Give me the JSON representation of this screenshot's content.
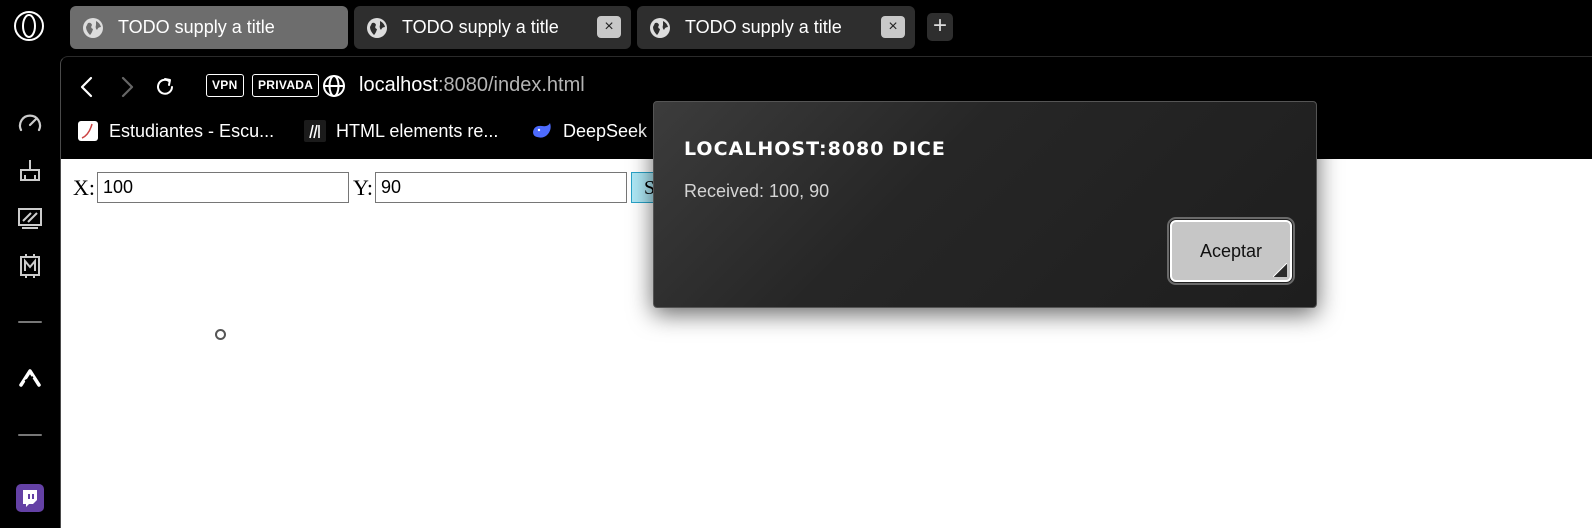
{
  "tabs": [
    {
      "title": "TODO supply a title",
      "active": true,
      "closable": false
    },
    {
      "title": "TODO supply a title",
      "active": false,
      "closable": true
    },
    {
      "title": "TODO supply a title",
      "active": false,
      "closable": true
    }
  ],
  "new_tab_label": "+",
  "tab_close_label": "×",
  "toolbar": {
    "vpn_badge": "VPN",
    "private_badge": "PRIVADA",
    "url_host": "localhost",
    "url_path": ":8080/index.html"
  },
  "bookmarks": [
    {
      "label": "Estudiantes - Escu...",
      "icon": "document-icon"
    },
    {
      "label": "HTML elements re...",
      "icon": "mdn-icon"
    },
    {
      "label": "DeepSeek",
      "icon": "whale-icon"
    }
  ],
  "sidebar": {
    "icons": [
      "speed-dial-icon",
      "cleaner-icon",
      "image-edit-icon",
      "m-chip-icon",
      "aria-icon",
      "twitch-icon"
    ]
  },
  "form": {
    "x_label": "X:",
    "x_value": "100",
    "y_label": "Y:",
    "y_value": "90",
    "submit_label": "S"
  },
  "dialog": {
    "title": "LOCALHOST:8080 DICE",
    "message": "Received: 100, 90",
    "ok_label": "Aceptar"
  },
  "colors": {
    "active_tab": "#6d6d6d",
    "inactive_tab": "#2e2e2e",
    "submit_bg": "#aee8f6",
    "twitch": "#6441a5"
  }
}
